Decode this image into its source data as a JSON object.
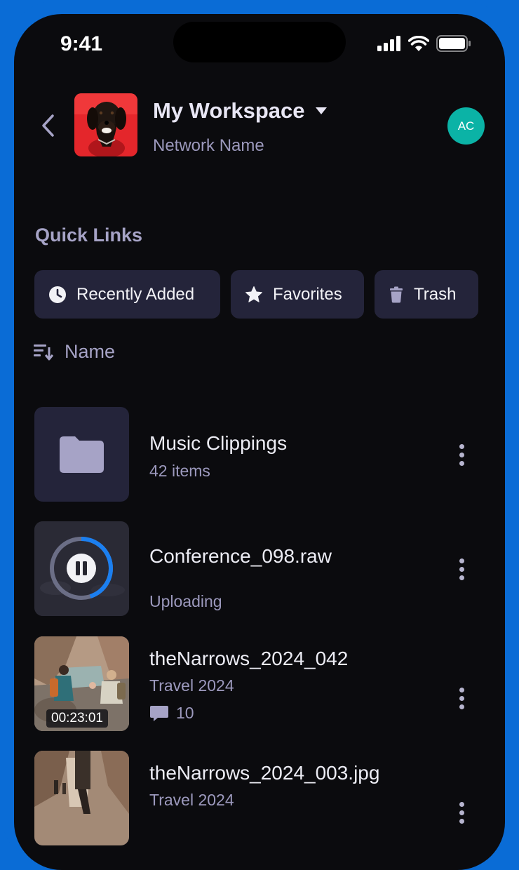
{
  "status_bar": {
    "time": "9:41"
  },
  "header": {
    "workspace_title": "My Workspace",
    "network_name": "Network Name",
    "avatar_initials": "AC"
  },
  "quick_links": {
    "heading": "Quick Links",
    "items": [
      {
        "label": "Recently Added",
        "icon": "clock-icon"
      },
      {
        "label": "Favorites",
        "icon": "star-icon"
      },
      {
        "label": "Trash",
        "icon": "trash-icon"
      }
    ]
  },
  "sort": {
    "label": "Name",
    "icon": "sort-icon"
  },
  "files": [
    {
      "title": "Music Clippings",
      "subtitle": "42 items",
      "type": "folder"
    },
    {
      "title": "Conference_098.raw",
      "subtitle": "Uploading",
      "type": "uploading",
      "upload_progress": 0.45
    },
    {
      "title": "theNarrows_2024_042",
      "subtitle": "Travel 2024",
      "type": "video",
      "duration": "00:23:01",
      "comment_count": "10"
    },
    {
      "title": "theNarrows_2024_003.jpg",
      "subtitle": "Travel 2024",
      "type": "image"
    }
  ],
  "colors": {
    "background": "#0b0b0e",
    "card": "#24243a",
    "accent_progress": "#1b7ff0",
    "avatar": "#0bb3a6",
    "frame": "#0a6cd6"
  }
}
